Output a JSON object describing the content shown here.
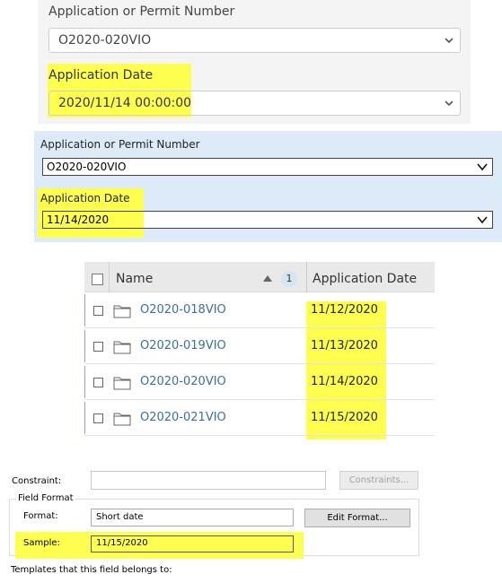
{
  "panel_web": {
    "permit_label": "Application or Permit Number",
    "permit_value": "O2020-020VIO",
    "date_label": "Application Date",
    "date_value": "2020/11/14 00:00:00"
  },
  "panel_desktop": {
    "permit_label": "Application or Permit Number",
    "permit_value": "O2020-020VIO",
    "date_label": "Application Date",
    "date_value": "11/14/2020"
  },
  "list": {
    "col_name": "Name",
    "sort_badge": "1",
    "col_date": "Application Date",
    "rows": [
      {
        "name": "O2020-018VIO",
        "date": "11/12/2020"
      },
      {
        "name": "O2020-019VIO",
        "date": "11/13/2020"
      },
      {
        "name": "O2020-020VIO",
        "date": "11/14/2020"
      },
      {
        "name": "O2020-021VIO",
        "date": "11/15/2020"
      }
    ]
  },
  "dialog": {
    "constraint_label": "Constraint:",
    "constraint_value": "",
    "constraints_button": "Constraints...",
    "field_format_title": "Field Format",
    "format_label": "Format:",
    "format_value": "Short date",
    "edit_format_button": "Edit Format...",
    "sample_label": "Sample:",
    "sample_value": "11/15/2020",
    "templates_label": "Templates that this field belongs to:"
  },
  "colors": {
    "highlight": "#fefe4e",
    "link": "#3a6ea5",
    "desktop_panel_bg": "#ddeaf8"
  }
}
